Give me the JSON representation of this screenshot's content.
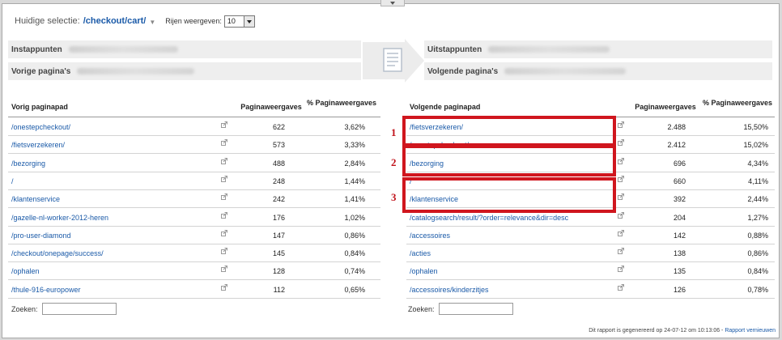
{
  "selection": {
    "label": "Huidige selectie:",
    "path": "/checkout/cart/",
    "rows_label": "Rijen weergeven:",
    "rows_value": "10"
  },
  "bars": {
    "entry": "Instappunten",
    "prev": "Vorige pagina's",
    "exit": "Uitstappunten",
    "next": "Volgende pagina's"
  },
  "left_table": {
    "col_path": "Vorig paginapad",
    "col_views": "Paginaweergaves",
    "col_pct": "% Paginaweergaves",
    "rows": [
      {
        "path": "/onestepcheckout/",
        "views": "622",
        "pct": "3,62%"
      },
      {
        "path": "/fietsverzekeren/",
        "views": "573",
        "pct": "3,33%"
      },
      {
        "path": "/bezorging",
        "views": "488",
        "pct": "2,84%"
      },
      {
        "path": "/",
        "views": "248",
        "pct": "1,44%"
      },
      {
        "path": "/klantenservice",
        "views": "242",
        "pct": "1,41%"
      },
      {
        "path": "/gazelle-nl-worker-2012-heren",
        "views": "176",
        "pct": "1,02%"
      },
      {
        "path": "/pro-user-diamond",
        "views": "147",
        "pct": "0,86%"
      },
      {
        "path": "/checkout/onepage/success/",
        "views": "145",
        "pct": "0,84%"
      },
      {
        "path": "/ophalen",
        "views": "128",
        "pct": "0,74%"
      },
      {
        "path": "/thule-916-europower",
        "views": "112",
        "pct": "0,65%"
      }
    ],
    "search_label": "Zoeken:"
  },
  "right_table": {
    "col_path": "Volgende paginapad",
    "col_views": "Paginaweergaves",
    "col_pct": "% Paginaweergaves",
    "rows": [
      {
        "path": "/fietsverzekeren/",
        "views": "2.488",
        "pct": "15,50%"
      },
      {
        "path": "/onestepcheckout/",
        "views": "2.412",
        "pct": "15,02%"
      },
      {
        "path": "/bezorging",
        "views": "696",
        "pct": "4,34%"
      },
      {
        "path": "/",
        "views": "660",
        "pct": "4,11%"
      },
      {
        "path": "/klantenservice",
        "views": "392",
        "pct": "2,44%"
      },
      {
        "path": "/catalogsearch/result/?order=relevance&dir=desc",
        "views": "204",
        "pct": "1,27%"
      },
      {
        "path": "/accessoires",
        "views": "142",
        "pct": "0,88%"
      },
      {
        "path": "/acties",
        "views": "138",
        "pct": "0,86%"
      },
      {
        "path": "/ophalen",
        "views": "135",
        "pct": "0,84%"
      },
      {
        "path": "/accessoires/kinderzitjes",
        "views": "126",
        "pct": "0,78%"
      }
    ],
    "search_label": "Zoeken:"
  },
  "annotations": [
    "1",
    "2",
    "3"
  ],
  "footer": {
    "text": "Dit rapport is gegenereerd op 24-07-12 om 10:13:06 - ",
    "link": "Rapport vernieuwen"
  },
  "colors": {
    "link": "#1a5aa8",
    "annotation_red": "#d0161e",
    "bar_bg": "#eeeeee"
  }
}
